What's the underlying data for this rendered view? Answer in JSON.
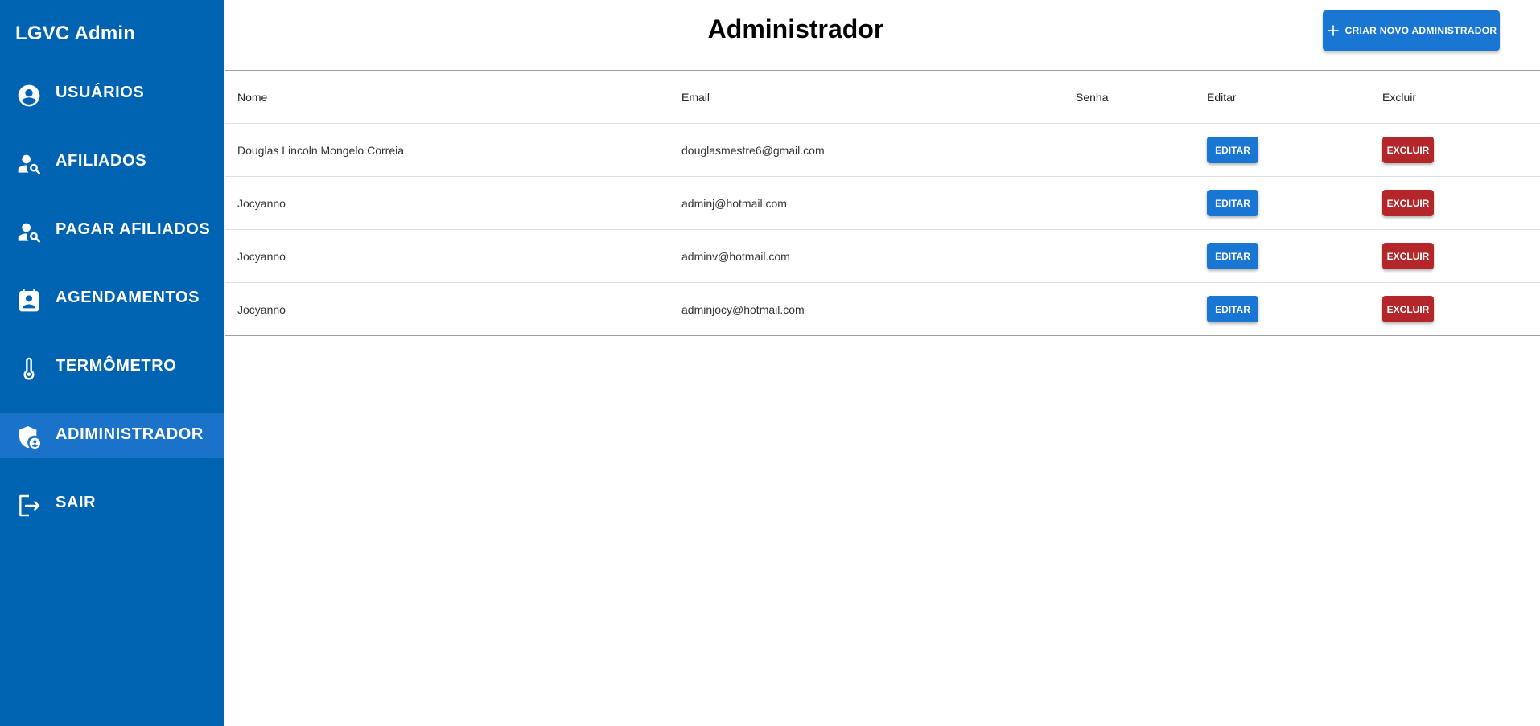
{
  "sidebar": {
    "brand": "LGVC Admin",
    "items": [
      {
        "label": "USUÁRIOS",
        "icon": "account-circle-icon"
      },
      {
        "label": "AFILIADOS",
        "icon": "person-search-icon"
      },
      {
        "label": "PAGAR AFILIADOS",
        "icon": "person-search-icon"
      },
      {
        "label": "AGENDAMENTOS",
        "icon": "assignment-ind-icon"
      },
      {
        "label": "TERMÔMETRO",
        "icon": "thermometer-icon"
      },
      {
        "label": "ADIMINISTRADOR",
        "icon": "admin-shield-icon",
        "active": true
      },
      {
        "label": "SAIR",
        "icon": "logout-icon"
      }
    ]
  },
  "header": {
    "title": "Administrador",
    "create_button": "CRIAR NOVO ADMINISTRADOR"
  },
  "table": {
    "columns": [
      "Nome",
      "Email",
      "Senha",
      "Editar",
      "Excluir"
    ],
    "rows": [
      {
        "nome": "Douglas Lincoln Mongelo Correia",
        "email": "douglasmestre6@gmail.com",
        "senha": "",
        "edit_label": "EDITAR",
        "delete_label": "EXCLUIR"
      },
      {
        "nome": "Jocyanno",
        "email": "adminj@hotmail.com",
        "senha": "",
        "edit_label": "EDITAR",
        "delete_label": "EXCLUIR"
      },
      {
        "nome": "Jocyanno",
        "email": "adminv@hotmail.com",
        "senha": "",
        "edit_label": "EDITAR",
        "delete_label": "EXCLUIR"
      },
      {
        "nome": "Jocyanno",
        "email": "adminjocy@hotmail.com",
        "senha": "",
        "edit_label": "EDITAR",
        "delete_label": "EXCLUIR"
      }
    ]
  },
  "colors": {
    "sidebar_bg": "#0063b1",
    "sidebar_active_bg": "#1a73c9",
    "primary": "#1976d2",
    "danger": "#b3262a"
  }
}
